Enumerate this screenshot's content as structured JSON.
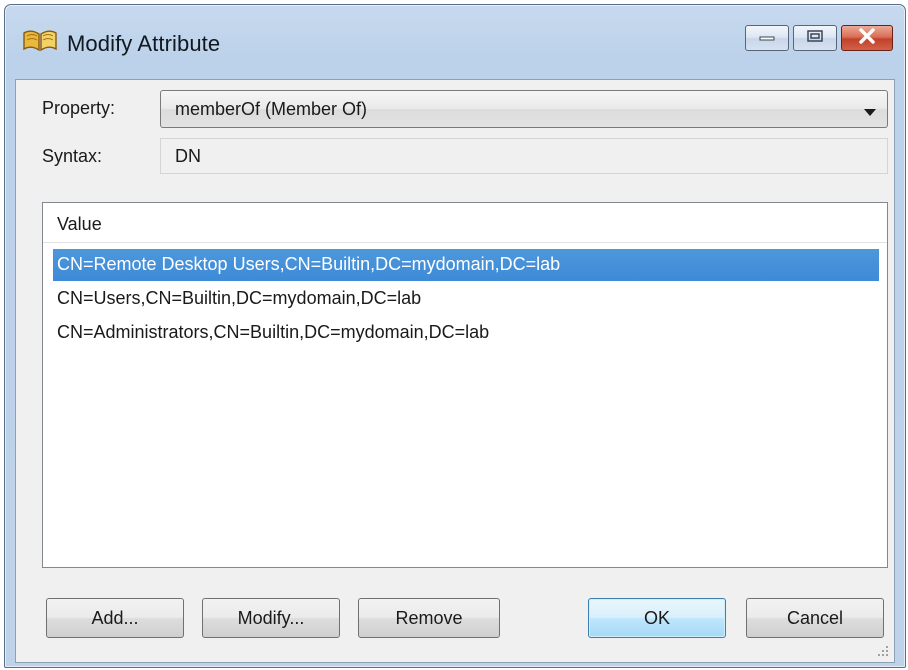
{
  "window": {
    "title": "Modify Attribute"
  },
  "property": {
    "label": "Property:",
    "value": "memberOf (Member Of)"
  },
  "syntax": {
    "label": "Syntax:",
    "value": "DN"
  },
  "list": {
    "header": "Value",
    "rows": [
      "CN=Remote Desktop Users,CN=Builtin,DC=mydomain,DC=lab",
      "CN=Users,CN=Builtin,DC=mydomain,DC=lab",
      "CN=Administrators,CN=Builtin,DC=mydomain,DC=lab"
    ],
    "selected_index": 0
  },
  "buttons": {
    "add": "Add...",
    "modify": "Modify...",
    "remove": "Remove",
    "ok": "OK",
    "cancel": "Cancel"
  },
  "icons": {
    "title": "book-icon",
    "minimize": "minimize-icon",
    "maximize": "maximize-icon",
    "close": "close-icon",
    "dropdown": "chevron-down-icon",
    "grip": "resize-grip-icon"
  },
  "colors": {
    "selection": "#3d8ad8",
    "close_button": "#c2412a",
    "default_button": "#bee6fd"
  }
}
